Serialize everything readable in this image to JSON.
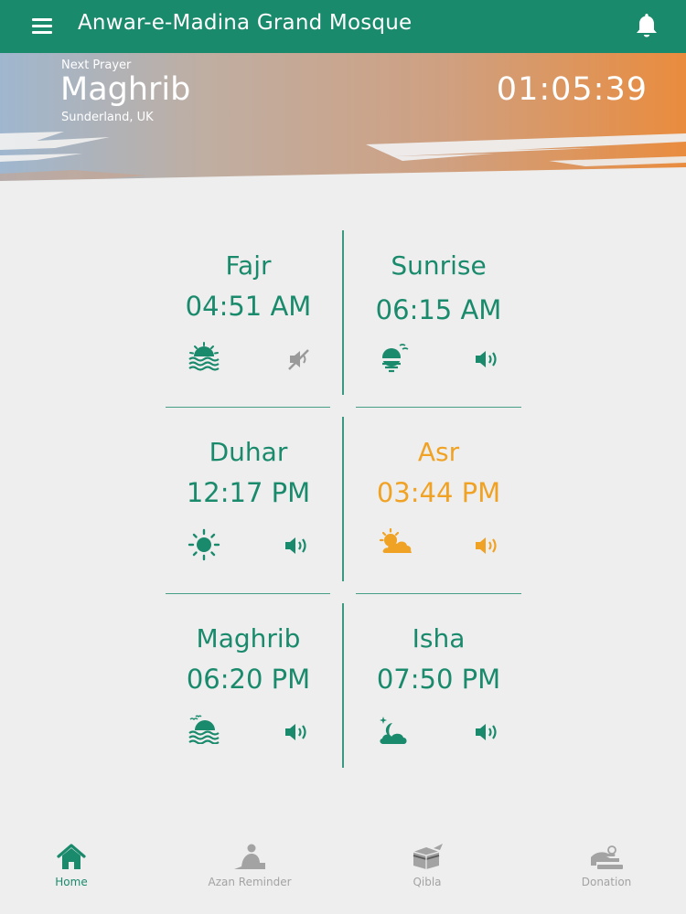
{
  "app": {
    "title": "Anwar-e-Madina Grand Mosque"
  },
  "hero": {
    "next_label": "Next Prayer",
    "next_name": "Maghrib",
    "location": "Sunderland, UK",
    "countdown": "01:05:39"
  },
  "colors": {
    "primary": "#1a8a6c",
    "active": "#f0a224",
    "inactive": "#a3a3a3",
    "background": "#eeeeee"
  },
  "prayers": [
    {
      "name": "Fajr",
      "time": "04:51 AM",
      "icon": "sunrise-waves-icon",
      "sound": "muted"
    },
    {
      "name": "Sunrise",
      "time": "06:15 AM",
      "icon": "sun-rising-icon",
      "sound": "on"
    },
    {
      "name": "Duhar",
      "time": "12:17 PM",
      "icon": "sun-icon",
      "sound": "on"
    },
    {
      "name": "Asr",
      "time": "03:44 PM",
      "icon": "sun-cloud-icon",
      "sound": "on",
      "active": true
    },
    {
      "name": "Maghrib",
      "time": "06:20 PM",
      "icon": "sunset-waves-icon",
      "sound": "on"
    },
    {
      "name": "Isha",
      "time": "07:50 PM",
      "icon": "moon-cloud-icon",
      "sound": "on"
    }
  ],
  "tabs": [
    {
      "label": "Home",
      "icon": "home-icon",
      "active": true
    },
    {
      "label": "Azan Reminder",
      "icon": "prayer-person-icon"
    },
    {
      "label": "Qibla",
      "icon": "kaaba-icon"
    },
    {
      "label": "Donation",
      "icon": "donation-hand-icon"
    }
  ]
}
